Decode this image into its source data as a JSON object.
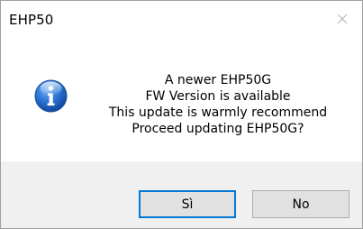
{
  "window": {
    "title": "EHP50",
    "close_glyph": "close-icon"
  },
  "message": {
    "icon": "info-icon",
    "lines": [
      "A newer EHP50G",
      "FW Version is available",
      "This update is warmly recommend",
      "Proceed updating EHP50G?"
    ]
  },
  "buttons": {
    "yes_label": "Sì",
    "no_label": "No"
  },
  "colors": {
    "accent": "#0078d7",
    "footer_bg": "#f0f0f0",
    "button_bg": "#e1e1e1",
    "icon_blue": "#1a5fc0"
  }
}
